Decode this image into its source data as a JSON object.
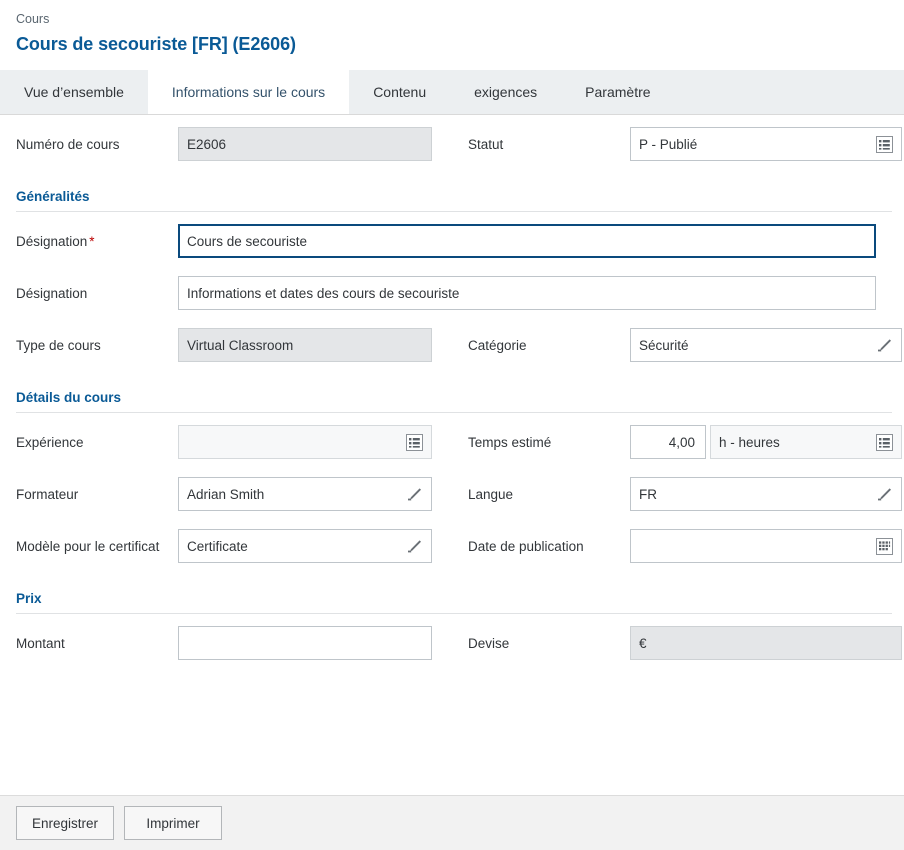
{
  "header": {
    "breadcrumb": "Cours",
    "title": "Cours de secouriste [FR] (E2606)"
  },
  "tabs": [
    {
      "label": "Vue d’ensemble",
      "active": false
    },
    {
      "label": "Informations sur le cours",
      "active": true
    },
    {
      "label": "Contenu",
      "active": false
    },
    {
      "label": "exigences",
      "active": false
    },
    {
      "label": "Paramètre",
      "active": false
    }
  ],
  "top": {
    "course_number_label": "Numéro de cours",
    "course_number_value": "E2606",
    "status_label": "Statut",
    "status_value": "P - Publié"
  },
  "general": {
    "section_title": "Généralités",
    "designation1_label": "Désignation",
    "designation1_required": "*",
    "designation1_value": "Cours de secouriste",
    "designation2_label": "Désignation",
    "designation2_value": "Informations et dates des cours de secouriste",
    "course_type_label": "Type de cours",
    "course_type_value": "Virtual Classroom",
    "category_label": "Catégorie",
    "category_value": "Sécurité"
  },
  "details": {
    "section_title": "Détails du cours",
    "experience_label": "Expérience",
    "experience_value": "",
    "estimated_time_label": "Temps estimé",
    "estimated_time_value": "4,00",
    "estimated_time_unit": "h - heures",
    "trainer_label": "Formateur",
    "trainer_value": "Adrian Smith",
    "language_label": "Langue",
    "language_value": "FR",
    "certificate_template_label": "Modèle pour le certificat",
    "certificate_template_value": "Certificate",
    "publication_date_label": "Date de publication",
    "publication_date_value": ""
  },
  "price": {
    "section_title": "Prix",
    "amount_label": "Montant",
    "amount_value": "",
    "currency_label": "Devise",
    "currency_value": "€"
  },
  "footer": {
    "save_label": "Enregistrer",
    "print_label": "Imprimer"
  },
  "icons": {
    "value_help_list": "list-value-help-icon",
    "edit_pencil": "pencil-edit-icon",
    "date_picker": "calendar-icon"
  },
  "colors": {
    "title_blue": "#0a5a96",
    "section_blue": "#0a5a96",
    "required_red": "#bb0000",
    "tabbar_bg": "#eceff1",
    "focus_border": "#0a4a7d",
    "footer_bg": "#f2f2f2"
  }
}
